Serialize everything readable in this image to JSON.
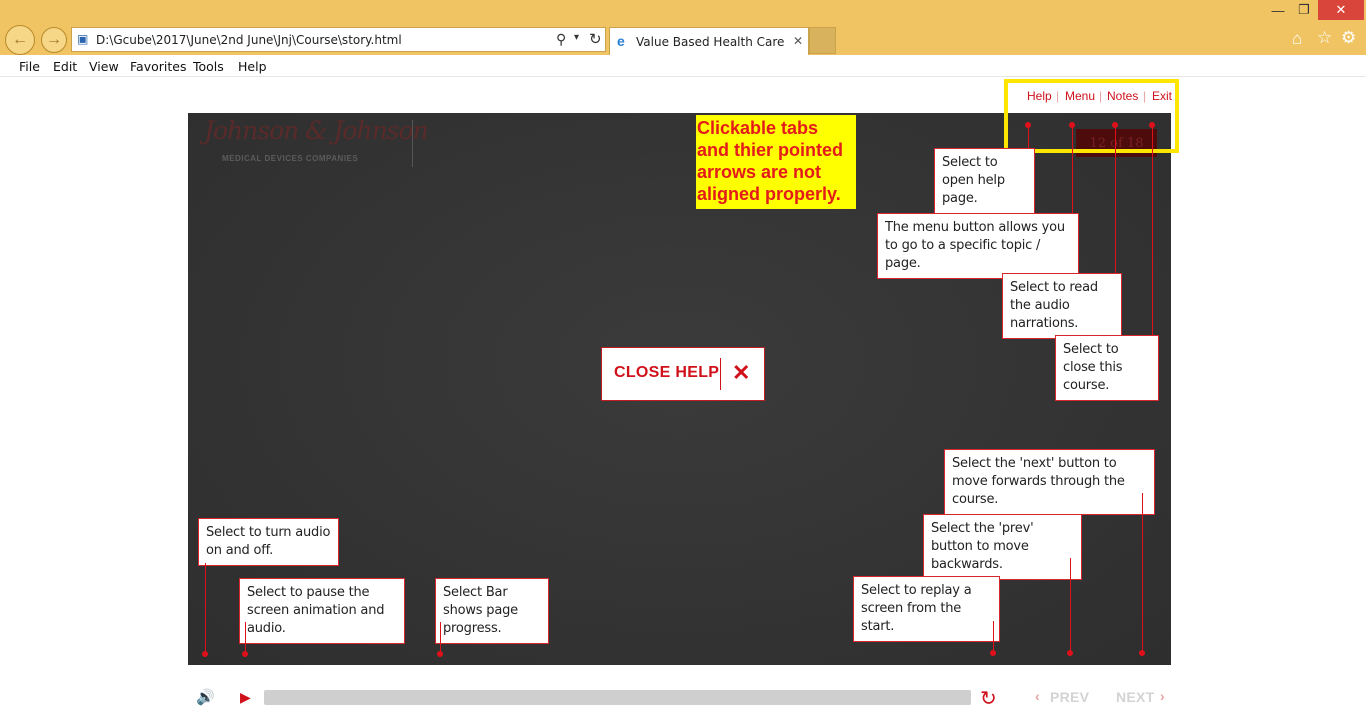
{
  "browser": {
    "address": "D:\\Gcube\\2017\\June\\2nd June\\Jnj\\Course\\story.html",
    "tab_title": "Value Based Health Care",
    "tab_close": "✕",
    "menu": [
      "File",
      "Edit",
      "View",
      "Favorites",
      "Tools",
      "Help"
    ],
    "icons": [
      "back-icon",
      "forward-icon",
      "search-icon",
      "refresh-icon",
      "ie-icon",
      "home-icon",
      "star-icon",
      "gear-icon"
    ]
  },
  "course": {
    "logo": "Johnson & Johnson",
    "logo_subtitle": "MEDICAL DEVICES COMPANIES",
    "page_counter": "12 of 18",
    "top_links": {
      "help": "Help",
      "menu": "Menu",
      "notes": "Notes",
      "exit": "Exit"
    },
    "close_help": "CLOSE HELP",
    "close_help_icon": "✕",
    "prev": "PREV",
    "next": "NEXT"
  },
  "annotation": {
    "text": "Clickable tabs and thier pointed arrows are not aligned properly."
  },
  "tooltips": {
    "help": "Select to open help page.",
    "menu": "The menu button allows you to go to a specific topic / page.",
    "notes": "Select to read the audio narrations.",
    "exit": "Select to close this course.",
    "next": "Select the 'next' button to move forwards through the course.",
    "prev": "Select the 'prev' button to move backwards.",
    "replay": "Select to replay a screen from the start.",
    "audio": "Select to turn audio on and off.",
    "pause": "Select to pause the screen animation and audio.",
    "bar": "Select Bar shows page progress."
  },
  "colors": {
    "accent": "#d0111b",
    "highlight": "#ffe600",
    "stage": "#333333"
  }
}
